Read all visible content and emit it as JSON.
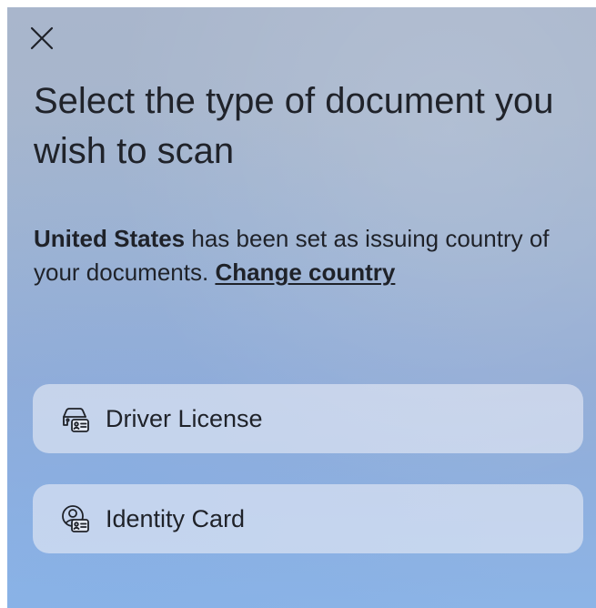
{
  "close": {
    "icon": "close-icon"
  },
  "title": "Select the type of document you wish to scan",
  "notice": {
    "country": "United States",
    "text": " has been set as issuing country of your documents. ",
    "link": "Change country"
  },
  "options": [
    {
      "label": "Driver License",
      "icon": "car-id-card-icon"
    },
    {
      "label": "Identity Card",
      "icon": "person-id-card-icon"
    }
  ],
  "colors": {
    "background_top": "#a9b6cc",
    "background_bottom": "#8cb4e6",
    "text": "#1f2229",
    "button_fill": "#e8ecf5"
  }
}
